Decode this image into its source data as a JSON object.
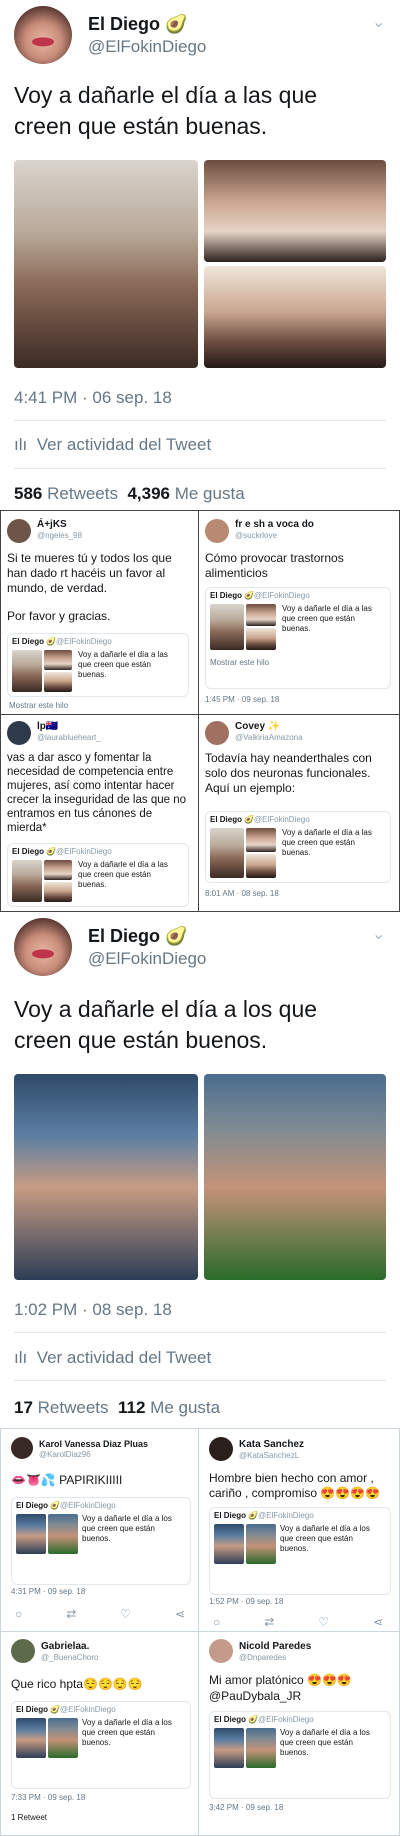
{
  "tweet1": {
    "name": "El Diego 🥑",
    "handle": "@ElFokinDiego",
    "text": "Voy a dañarle el día a las que creen que están buenas.",
    "time": "4:41 PM · 06 sep. 18",
    "activity": "Ver actividad del Tweet",
    "retweets_num": "586",
    "retweets_label": "Retweets",
    "likes_num": "4,396",
    "likes_label": "Me gusta"
  },
  "replies1": [
    {
      "name": "Á+jKS",
      "handle": "@ngeles_98",
      "text": "Si te mueres tú y todos los que han dado rt hacéis un favor al mundo, de verdad.",
      "text2": "Por favor y gracias.",
      "footer": "Mostrar este hilo"
    },
    {
      "name": "fr e sh a voca do",
      "handle": "@suckrlove",
      "text": "Cómo provocar trastornos alimenticios",
      "footer": "Mostrar este hilo",
      "time": "1:45 PM · 09 sep. 18"
    },
    {
      "name": "lp🇦🇺",
      "handle": "@laurablueheart_",
      "text": "vas a dar asco y fomentar la necesidad de competencia entre mujeres, así como intentar hacer crecer la inseguridad de las que no entramos en tus cánones de mierda*"
    },
    {
      "name": "Covey ✨",
      "handle": "@ValkiriaAmazona",
      "text": "Todavía hay neanderthales con solo dos neuronas funcionales. Aquí un ejemplo:",
      "time": "8:01 AM · 08 sep. 18"
    }
  ],
  "quote": {
    "name": "El Diego 🥑",
    "handle": "@ElFokinDiego",
    "text1": "Voy a dañarle el día a las que creen que están buenas.",
    "text2": "Voy a dañarle el día a los que creen que están buenos."
  },
  "tweet2": {
    "name": "El Diego 🥑",
    "handle": "@ElFokinDiego",
    "text": "Voy a dañarle el día a los que creen que están buenos.",
    "time": "1:02 PM · 08 sep. 18",
    "activity": "Ver actividad del Tweet",
    "retweets_num": "17",
    "retweets_label": "Retweets",
    "likes_num": "112",
    "likes_label": "Me gusta"
  },
  "replies2": [
    {
      "name": "Karol Vanessa Diaz Pluas",
      "handle": "@KarolDiaz96",
      "text": "👄👅💦 PAPIRIKIIIII",
      "time": "4:31 PM · 09 sep. 18"
    },
    {
      "name": "Kata Sanchez",
      "handle": "@KataSanchezL",
      "text": "Hombre bien hecho con amor , cariño , compromiso 😍😍😍😍",
      "time": "1:52 PM · 09 sep. 18"
    },
    {
      "name": "Gabrielaa.",
      "handle": "@_BuenaChoro",
      "text": "Que rico hpta😌😌😌😌",
      "time": "7:33 PM · 09 sep. 18",
      "retweet": "1 Retweet"
    },
    {
      "name": "Nicold Paredes",
      "handle": "@Dnparedes",
      "text": "Mi amor platónico 😍😍😍",
      "mention": "@PauDybala_JR",
      "time": "3:42 PM · 09 sep. 18"
    }
  ]
}
